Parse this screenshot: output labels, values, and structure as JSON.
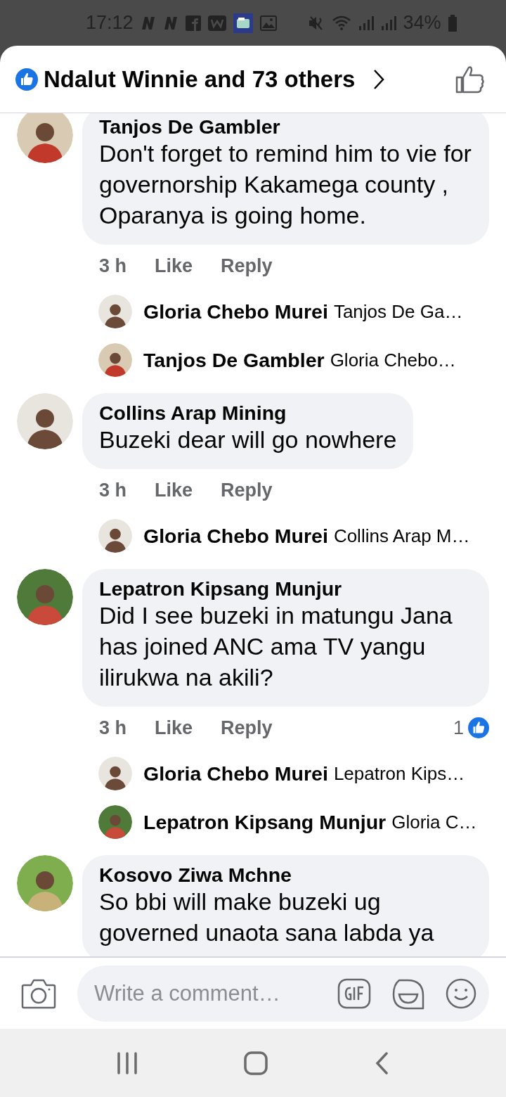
{
  "status_bar": {
    "time": "17:12",
    "battery": "34%"
  },
  "header": {
    "title": "Ndalut Winnie and 73 others"
  },
  "comments": [
    {
      "author": "Tanjos De Gambler",
      "text": "Don't forget to remind him to vie for governorship Kakamega county , Oparanya is going home.",
      "time": "3 h",
      "like_label": "Like",
      "reply_label": "Reply",
      "replies": [
        {
          "author": "Gloria Chebo Murei",
          "snippet": "Tanjos De Ga…"
        },
        {
          "author": "Tanjos De Gambler",
          "snippet": "Gloria Chebo…"
        }
      ]
    },
    {
      "author": "Collins Arap Mining",
      "text": "Buzeki dear will go nowhere",
      "time": "3 h",
      "like_label": "Like",
      "reply_label": "Reply",
      "replies": [
        {
          "author": "Gloria Chebo Murei",
          "snippet": "Collins Arap M…"
        }
      ]
    },
    {
      "author": "Lepatron Kipsang Munjur",
      "text": "Did I see buzeki in matungu Jana has joined ANC ama TV yangu ilirukwa na akili?",
      "time": "3 h",
      "like_label": "Like",
      "reply_label": "Reply",
      "reaction_count": "1",
      "replies": [
        {
          "author": "Gloria Chebo Murei",
          "snippet": "Lepatron Kips…"
        },
        {
          "author": "Lepatron Kipsang Munjur",
          "snippet": "Gloria C…"
        }
      ]
    },
    {
      "author": "Kosovo Ziwa Mchne",
      "text": "So bbi will make buzeki ug governed unaota sana labda ya"
    }
  ],
  "composer": {
    "placeholder": "Write a comment…"
  }
}
